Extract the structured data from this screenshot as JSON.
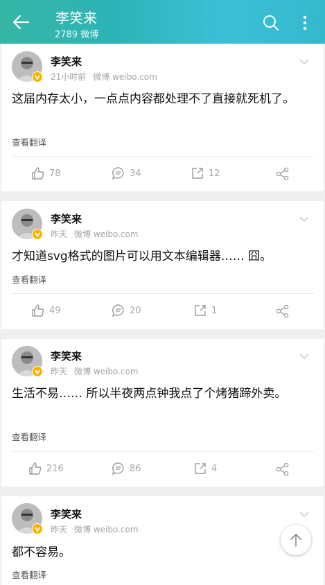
{
  "header": {
    "title": "李笑来",
    "subtitle": "2789 微博"
  },
  "posts": [
    {
      "name": "李笑来",
      "time": "21小时前",
      "source": "微博 weibo.com",
      "text": "这届内存太小，一点点内容都处理不了直接就死机了。",
      "translate": "查看翻译",
      "likes": "78",
      "comments": "34",
      "reposts": "12"
    },
    {
      "name": "李笑来",
      "time": "昨天",
      "source": "微博 weibo.com",
      "text": "才知道svg格式的图片可以用文本编辑器…… 囧。",
      "translate": "查看翻译",
      "likes": "49",
      "comments": "20",
      "reposts": "1"
    },
    {
      "name": "李笑来",
      "time": "昨天",
      "source": "微博 weibo.com",
      "text": "生活不易…… 所以半夜两点钟我点了个烤猪蹄外卖。",
      "translate": "查看翻译",
      "likes": "216",
      "comments": "86",
      "reposts": "4"
    },
    {
      "name": "李笑来",
      "time": "昨天",
      "source": "微博 weibo.com",
      "text": "都不容易。",
      "translate": "查看翻译"
    }
  ],
  "icons": {
    "back": "arrow-left-icon",
    "search": "search-icon",
    "more": "more-vertical-icon",
    "like": "thumbs-up-icon",
    "comment": "comment-icon",
    "repost": "repost-icon",
    "share": "share-icon",
    "expand": "chevron-down-icon",
    "verified": "verified-badge-icon",
    "scroll_top": "arrow-up-icon"
  },
  "colors": {
    "header_gradient_start": "#36b6a4",
    "header_gradient_end": "#33b8cc",
    "verified": "#f7b500",
    "muted": "#a8a8a8"
  }
}
